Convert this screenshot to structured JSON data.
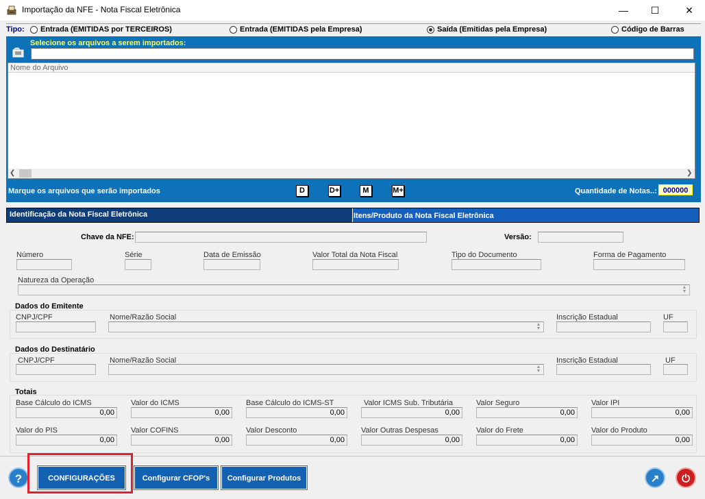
{
  "window": {
    "title": "Importação da NFE - Nota Fiscal Eletrônica",
    "minimize_glyph": "—",
    "maximize_glyph": "☐",
    "close_glyph": "✕"
  },
  "tipo": {
    "label": "Tipo:",
    "options": [
      {
        "label": "Entrada (EMITIDAS por TERCEIROS)",
        "selected": false
      },
      {
        "label": "Entrada (EMITIDAS pela Empresa)",
        "selected": false
      },
      {
        "label": "Saída (Emitidas pela Empresa)",
        "selected": true
      },
      {
        "label": "Código de Barras",
        "selected": false
      }
    ]
  },
  "import_panel": {
    "select_label": "Selecione os arquivos a serem importados:",
    "file_path": "",
    "list_header": "Nome do Arquivo",
    "mark_label": "Marque os arquivos que serão importados",
    "mark_buttons": [
      "D",
      "D+",
      "M",
      "M+"
    ],
    "quantity_label": "Quantidade de Notas..:",
    "quantity_value": "000000"
  },
  "tabs": [
    {
      "label": "Identificação da Nota Fiscal Eletrônica",
      "active": true
    },
    {
      "label": "Itens/Produto da Nota Fiscal Eletrônica",
      "active": false
    }
  ],
  "nfe": {
    "chave_label": "Chave da NFE:",
    "versao_label": "Versão:",
    "numero_label": "Número",
    "serie_label": "Série",
    "data_emissao_label": "Data de Emissão",
    "valor_total_label": "Valor Total da Nota Fiscal",
    "tipo_documento_label": "Tipo do Documento",
    "forma_pagamento_label": "Forma de Pagamento",
    "natureza_label": "Natureza da Operação"
  },
  "emitente": {
    "title": "Dados do Emitente",
    "cnpj_label": "CNPJ/CPF",
    "nome_label": "Nome/Razão Social",
    "ie_label": "Inscrição Estadual",
    "uf_label": "UF"
  },
  "destinatario": {
    "title": "Dados do Destinatário",
    "cnpj_label": "CNPJ/CPF",
    "nome_label": "Nome/Razão Social",
    "ie_label": "Inscrição Estadual",
    "uf_label": "UF"
  },
  "totais": {
    "title": "Totais",
    "fields": [
      {
        "label": "Base Cálculo do ICMS",
        "value": "0,00"
      },
      {
        "label": "Valor do ICMS",
        "value": "0,00"
      },
      {
        "label": "Base Cálculo do ICMS-ST",
        "value": "0,00"
      },
      {
        "label": "Valor ICMS Sub. Tributária",
        "value": "0,00"
      },
      {
        "label": "Valor Seguro",
        "value": "0,00"
      },
      {
        "label": "Valor IPI",
        "value": "0,00"
      },
      {
        "label": "Valor do PIS",
        "value": "0,00"
      },
      {
        "label": "Valor COFINS",
        "value": "0,00"
      },
      {
        "label": "Valor Desconto",
        "value": "0,00"
      },
      {
        "label": "Valor Outras Despesas",
        "value": "0,00"
      },
      {
        "label": "Valor do Frete",
        "value": "0,00"
      },
      {
        "label": "Valor do Produto",
        "value": "0,00"
      }
    ]
  },
  "bottom": {
    "help_glyph": "?",
    "configuracoes": "CONFIGURAÇÕES",
    "configurar_cfop": "Configurar CFOP's",
    "configurar_produtos": "Configurar Produtos",
    "export_glyph": "↗",
    "power_glyph": "⏻",
    "colors": {
      "button_blue": "#1561b1",
      "highlight_red": "#e0202a",
      "power_red": "#cc1f1f"
    }
  }
}
